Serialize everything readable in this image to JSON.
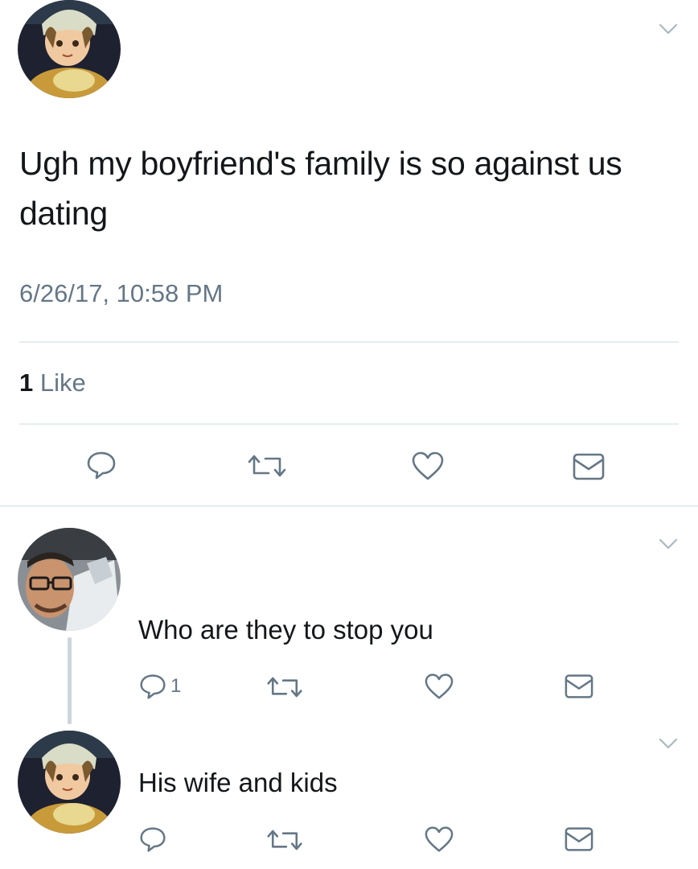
{
  "tweet": {
    "avatar": "anime-character-avatar",
    "text": "Ugh my boyfriend's family is so against us dating",
    "timestamp": "6/26/17, 10:58 PM",
    "likes_count": "1",
    "likes_label": "Like",
    "actions": [
      "reply-icon",
      "retweet-icon",
      "like-icon",
      "share-icon"
    ]
  },
  "replies": [
    {
      "avatar": "man-with-glasses-avatar",
      "text": "Who are they to stop you",
      "reply_count": "1",
      "actions": [
        "reply-icon",
        "retweet-icon",
        "like-icon",
        "share-icon"
      ]
    },
    {
      "avatar": "anime-character-avatar",
      "text": "His wife and kids",
      "reply_count": "",
      "actions": [
        "reply-icon",
        "retweet-icon",
        "like-icon",
        "share-icon"
      ]
    }
  ],
  "colors": {
    "text": "#14171a",
    "secondary": "#657786",
    "divider": "#e6ecf0",
    "thread_line": "#ccd6dd",
    "background": "#ffffff"
  }
}
